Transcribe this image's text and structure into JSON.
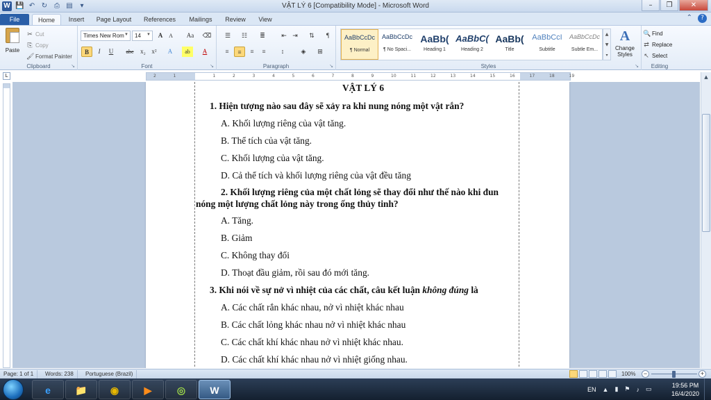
{
  "window": {
    "title": "VẬT LÝ 6 [Compatibility Mode]  -  Microsoft Word",
    "app_icon_letter": "W",
    "minimize": "–",
    "restore": "❐",
    "close": "✕"
  },
  "qat": {
    "save": "💾",
    "undo": "↶",
    "redo": "↻",
    "print": "⎙",
    "preview": "▤",
    "more": "▾"
  },
  "tabs": [
    "File",
    "Home",
    "Insert",
    "Page Layout",
    "References",
    "Mailings",
    "Review",
    "View"
  ],
  "ribbon": {
    "clipboard": {
      "label": "Clipboard",
      "paste": "Paste",
      "cut": "Cut",
      "copy": "Copy",
      "format_painter": "Format Painter"
    },
    "font": {
      "label": "Font",
      "font_name": "Times New Rom",
      "font_size": "14",
      "grow": "A",
      "shrink": "A",
      "change_case": "Aa",
      "bold": "B",
      "italic": "I",
      "underline": "U",
      "strikethrough": "abc",
      "subscript": "x₂",
      "superscript": "x²",
      "text_effects": "A",
      "highlight": "ab",
      "font_color": "A"
    },
    "paragraph": {
      "label": "Paragraph",
      "show_hide": "¶"
    },
    "styles": {
      "label": "Styles",
      "items": [
        {
          "sample": "AaBbCcDc",
          "name": "¶ Normal"
        },
        {
          "sample": "AaBbCcDc",
          "name": "¶ No Spaci..."
        },
        {
          "sample": "AaBb(",
          "name": "Heading 1"
        },
        {
          "sample": "AaBbC(",
          "name": "Heading 2"
        },
        {
          "sample": "AaBb(",
          "name": "Title"
        },
        {
          "sample": "AaBbCcI",
          "name": "Subtitle"
        },
        {
          "sample": "AaBbCcDc",
          "name": "Subtle Em..."
        }
      ],
      "change_styles": "Change Styles"
    },
    "editing": {
      "label": "Editing",
      "find": "Find",
      "replace": "Replace",
      "select": "Select"
    }
  },
  "ruler_numbers": [
    "2",
    "1",
    "1",
    "2",
    "3",
    "4",
    "5",
    "6",
    "7",
    "8",
    "9",
    "10",
    "11",
    "12",
    "13",
    "14",
    "15",
    "16",
    "17",
    "18",
    "19"
  ],
  "document": {
    "title": "VẬT LÝ 6",
    "q1": "1. Hiện tượng nào sau đây sẽ xảy ra khi nung nóng một vật rắn?",
    "q1_a": "A. Khối lượng riêng của vật tăng.",
    "q1_b": "B. Thể tích của vật tăng.",
    "q1_c": "C. Khối lượng của vật tăng.",
    "q1_d": "D. Cả thể tích và khối lượng riêng của vật đều tăng",
    "q2_l1": "2. Khối lượng riêng của một chất lỏng sẽ thay đổi như thế nào khi đun",
    "q2_l2": "nóng một lượng chất lỏng này trong ống thủy tinh?",
    "q2_a": "A. Tăng.",
    "q2_b": "B. Giảm",
    "q2_c": "C. Không thay đổi",
    "q2_d": "D. Thoạt đầu giảm, rồi sau đó mới tăng.",
    "q3_pre": "3. Khi nói về sự nở vì nhiệt của các chất, câu kết luận ",
    "q3_em": "không đúng",
    "q3_post": " là",
    "q3_a": "A. Các chất rắn khác nhau, nở vì nhiệt khác nhau",
    "q3_b": "B. Các chất lỏng khác nhau nở vì nhiệt khác nhau",
    "q3_c": "C. Các chất khí khác nhau nở vì nhiệt khác nhau.",
    "q3_d": "D. Các chất khí khác nhau nở vì nhiệt giống nhau."
  },
  "status": {
    "page": "Page: 1 of 1",
    "words": "Words: 238",
    "language": "Portuguese (Brazil)",
    "zoom": "100%",
    "zoom_minus": "−",
    "zoom_plus": "+"
  },
  "taskbar": {
    "apps": [
      "e",
      "📁",
      "◉",
      "▶",
      "◎",
      "W"
    ],
    "lang": "EN",
    "clock_time": "19:56 PM",
    "clock_date": "16/4/2020"
  }
}
